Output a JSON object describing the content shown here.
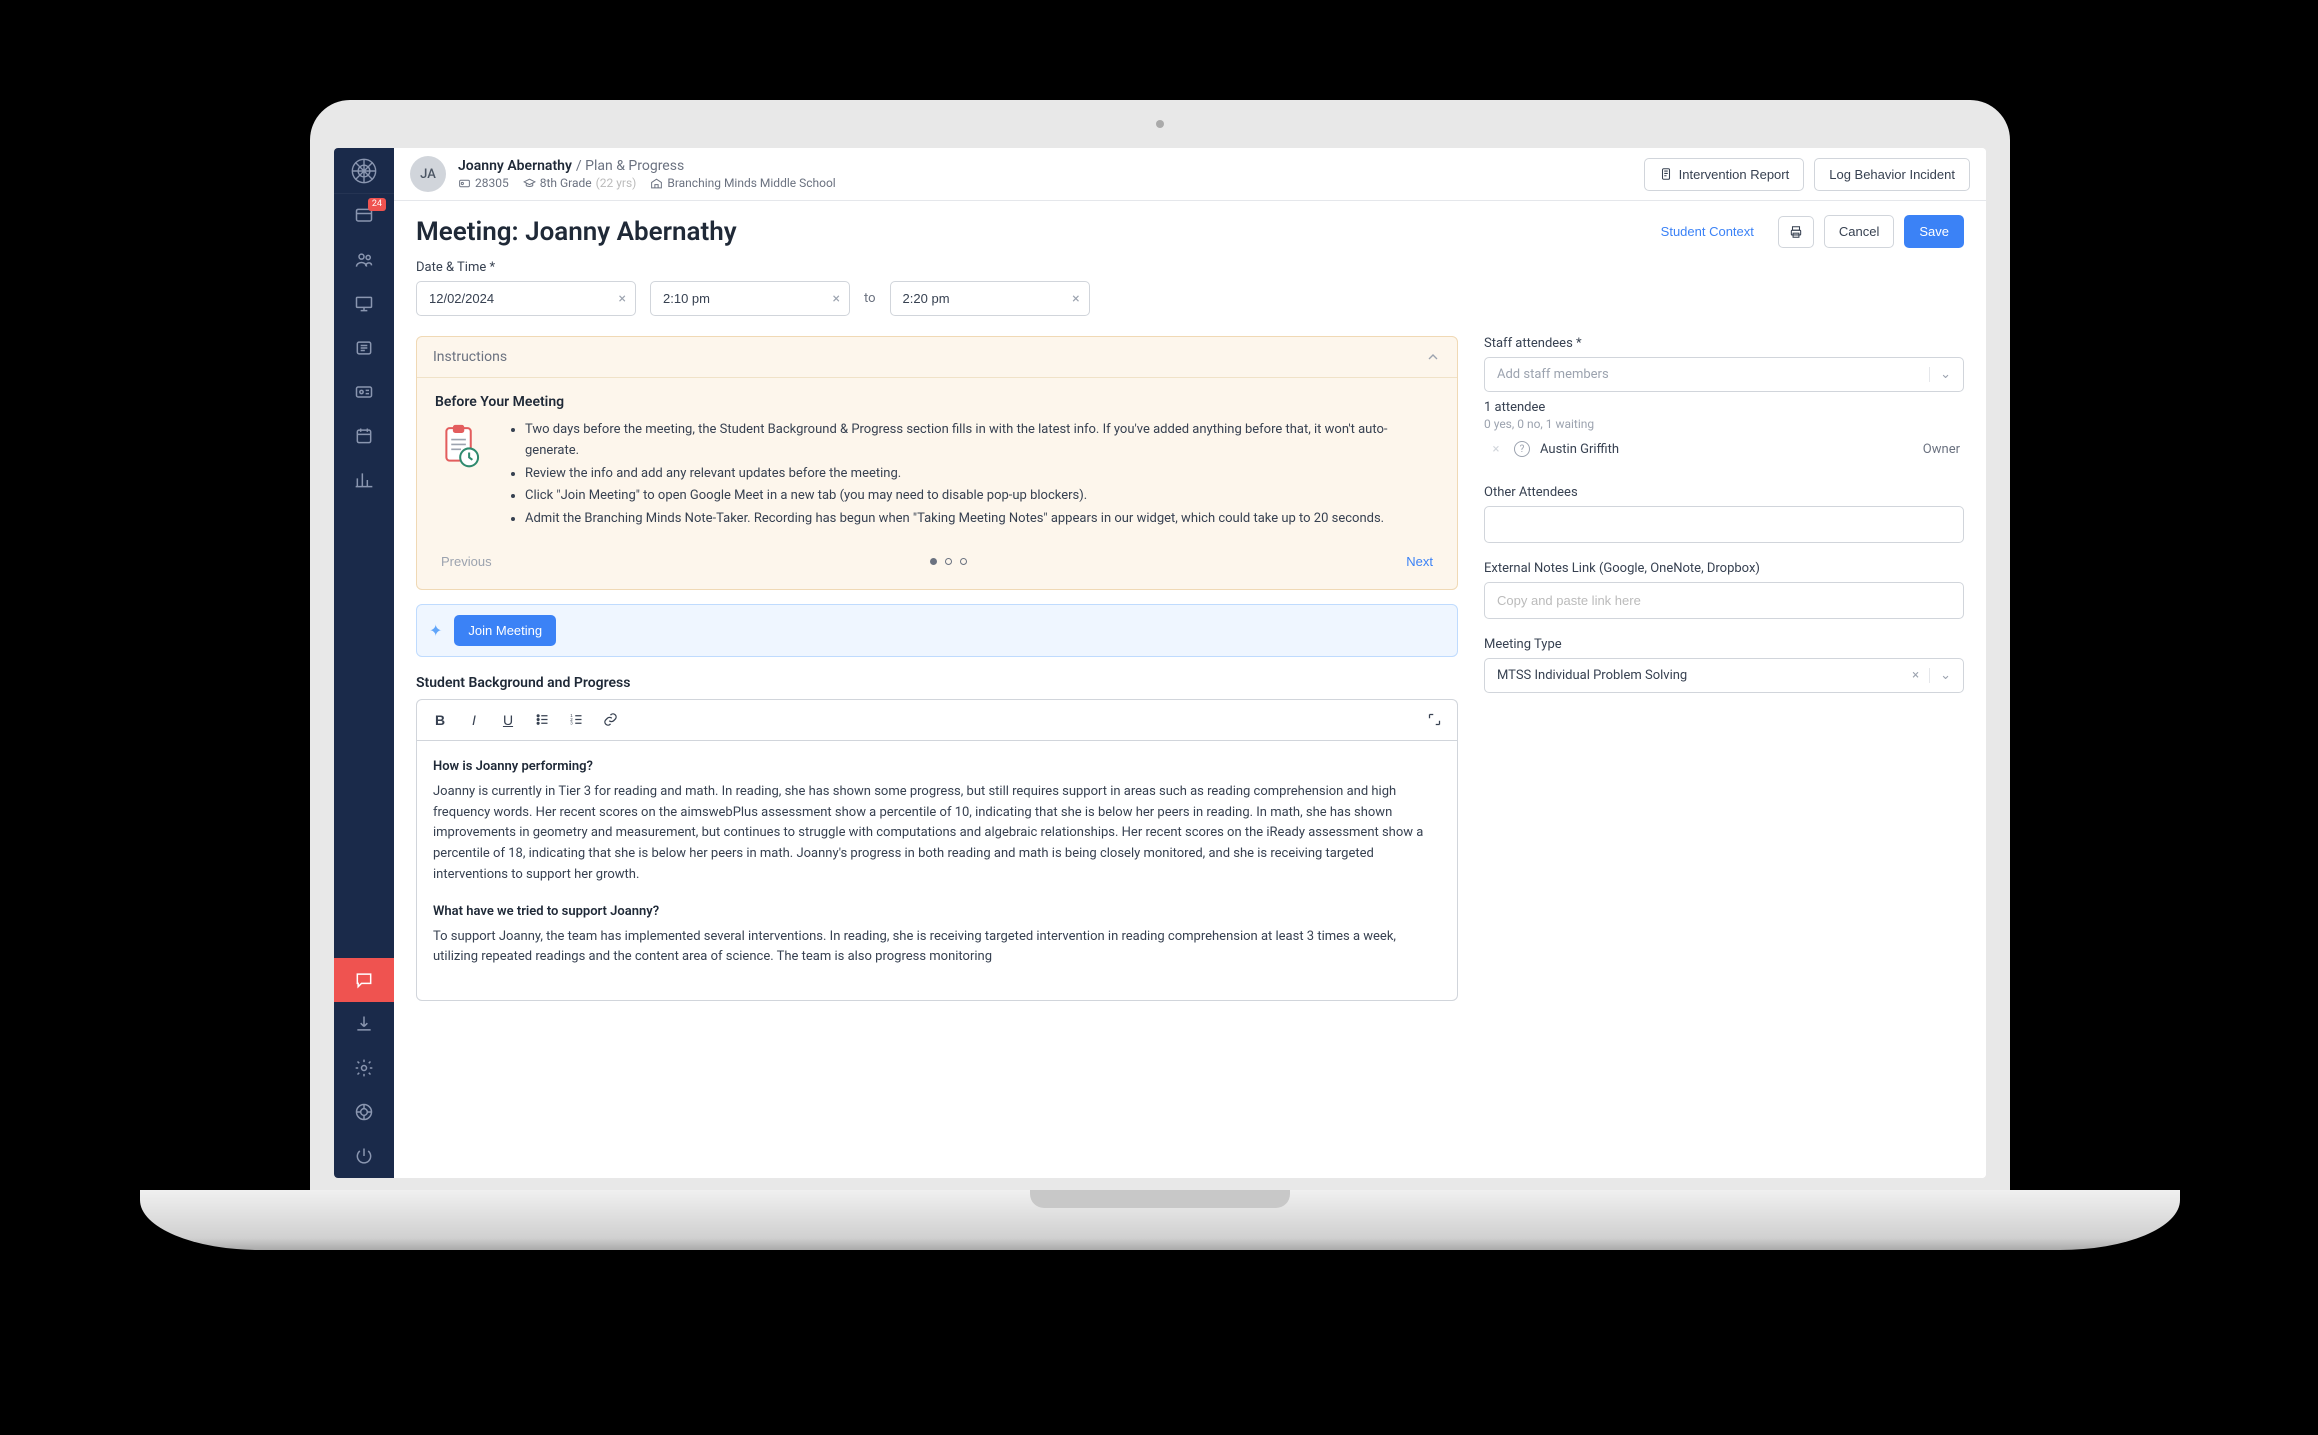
{
  "sidebar": {
    "badge": "24"
  },
  "topbar": {
    "avatar_initials": "JA",
    "student_name": "Joanny Abernathy",
    "breadcrumb": "/ Plan & Progress",
    "id": "28305",
    "grade": "8th Grade",
    "age": "(22 yrs)",
    "school": "Branching Minds Middle School",
    "intervention_btn": "Intervention Report",
    "log_behavior_btn": "Log Behavior Incident"
  },
  "header": {
    "title": "Meeting: Joanny Abernathy",
    "student_context_btn": "Student Context",
    "cancel_btn": "Cancel",
    "save_btn": "Save"
  },
  "datetime": {
    "label": "Date & Time *",
    "date": "12/02/2024",
    "start": "2:10 pm",
    "to": "to",
    "end": "2:20 pm"
  },
  "instructions": {
    "title": "Instructions",
    "heading": "Before Your Meeting",
    "bullets": [
      "Two days before the meeting, the Student Background & Progress section fills in with the latest info. If you've added anything before that, it won't auto-generate.",
      "Review the info and add any relevant updates before the meeting.",
      "Click \"Join Meeting\" to open Google Meet in a new tab (you may need to disable pop-up blockers).",
      "Admit the Branching Minds Note-Taker. Recording has begun when \"Taking Meeting Notes\" appears in our widget, which could take up to 20 seconds."
    ],
    "prev": "Previous",
    "next": "Next"
  },
  "join": {
    "button": "Join Meeting"
  },
  "background": {
    "section_title": "Student Background and Progress",
    "q1": "How is Joanny performing?",
    "a1": "Joanny is currently in Tier 3 for reading and math. In reading, she has shown some progress, but still requires support in areas such as reading comprehension and high frequency words. Her recent scores on the aimswebPlus assessment show a percentile of 10, indicating that she is below her peers in reading. In math, she has shown improvements in geometry and measurement, but continues to struggle with computations and algebraic relationships. Her recent scores on the iReady assessment show a percentile of 18, indicating that she is below her peers in math. Joanny's progress in both reading and math is being closely monitored, and she is receiving targeted interventions to support her growth.",
    "q2": "What have we tried to support Joanny?",
    "a2": "To support Joanny, the team has implemented several interventions. In reading, she is receiving targeted intervention in reading comprehension at least 3 times a week, utilizing repeated readings and the content area of science. The team is also progress monitoring"
  },
  "right": {
    "staff_label": "Staff attendees *",
    "staff_placeholder": "Add staff members",
    "attendee_count": "1 attendee",
    "attendee_status": "0 yes, 0 no, 1 waiting",
    "attendee_name": "Austin Griffith",
    "attendee_role": "Owner",
    "other_label": "Other Attendees",
    "notes_label": "External Notes Link (Google, OneNote, Dropbox)",
    "notes_placeholder": "Copy and paste link here",
    "type_label": "Meeting Type",
    "type_value": "MTSS Individual Problem Solving"
  }
}
